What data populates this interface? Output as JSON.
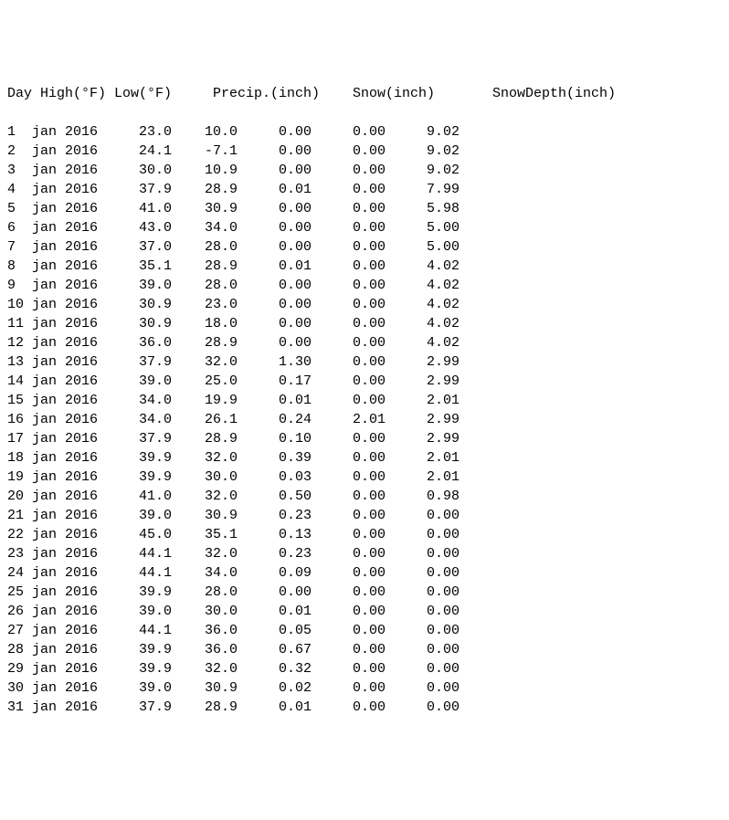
{
  "headers": {
    "day": "Day",
    "high": "High(°F)",
    "low": "Low(°F)",
    "precip": "Precip.(inch)",
    "snow": "Snow(inch)",
    "depth": "SnowDepth(inch)"
  },
  "rows": [
    {
      "day": "1",
      "date": "jan 2016",
      "high": "23.0",
      "low": "10.0",
      "precip": "0.00",
      "snow": "0.00",
      "depth": "9.02"
    },
    {
      "day": "2",
      "date": "jan 2016",
      "high": "24.1",
      "low": "-7.1",
      "precip": "0.00",
      "snow": "0.00",
      "depth": "9.02"
    },
    {
      "day": "3",
      "date": "jan 2016",
      "high": "30.0",
      "low": "10.9",
      "precip": "0.00",
      "snow": "0.00",
      "depth": "9.02"
    },
    {
      "day": "4",
      "date": "jan 2016",
      "high": "37.9",
      "low": "28.9",
      "precip": "0.01",
      "snow": "0.00",
      "depth": "7.99"
    },
    {
      "day": "5",
      "date": "jan 2016",
      "high": "41.0",
      "low": "30.9",
      "precip": "0.00",
      "snow": "0.00",
      "depth": "5.98"
    },
    {
      "day": "6",
      "date": "jan 2016",
      "high": "43.0",
      "low": "34.0",
      "precip": "0.00",
      "snow": "0.00",
      "depth": "5.00"
    },
    {
      "day": "7",
      "date": "jan 2016",
      "high": "37.0",
      "low": "28.0",
      "precip": "0.00",
      "snow": "0.00",
      "depth": "5.00"
    },
    {
      "day": "8",
      "date": "jan 2016",
      "high": "35.1",
      "low": "28.9",
      "precip": "0.01",
      "snow": "0.00",
      "depth": "4.02"
    },
    {
      "day": "9",
      "date": "jan 2016",
      "high": "39.0",
      "low": "28.0",
      "precip": "0.00",
      "snow": "0.00",
      "depth": "4.02"
    },
    {
      "day": "10",
      "date": "jan 2016",
      "high": "30.9",
      "low": "23.0",
      "precip": "0.00",
      "snow": "0.00",
      "depth": "4.02"
    },
    {
      "day": "11",
      "date": "jan 2016",
      "high": "30.9",
      "low": "18.0",
      "precip": "0.00",
      "snow": "0.00",
      "depth": "4.02"
    },
    {
      "day": "12",
      "date": "jan 2016",
      "high": "36.0",
      "low": "28.9",
      "precip": "0.00",
      "snow": "0.00",
      "depth": "4.02"
    },
    {
      "day": "13",
      "date": "jan 2016",
      "high": "37.9",
      "low": "32.0",
      "precip": "1.30",
      "snow": "0.00",
      "depth": "2.99"
    },
    {
      "day": "14",
      "date": "jan 2016",
      "high": "39.0",
      "low": "25.0",
      "precip": "0.17",
      "snow": "0.00",
      "depth": "2.99"
    },
    {
      "day": "15",
      "date": "jan 2016",
      "high": "34.0",
      "low": "19.9",
      "precip": "0.01",
      "snow": "0.00",
      "depth": "2.01"
    },
    {
      "day": "16",
      "date": "jan 2016",
      "high": "34.0",
      "low": "26.1",
      "precip": "0.24",
      "snow": "2.01",
      "depth": "2.99"
    },
    {
      "day": "17",
      "date": "jan 2016",
      "high": "37.9",
      "low": "28.9",
      "precip": "0.10",
      "snow": "0.00",
      "depth": "2.99"
    },
    {
      "day": "18",
      "date": "jan 2016",
      "high": "39.9",
      "low": "32.0",
      "precip": "0.39",
      "snow": "0.00",
      "depth": "2.01"
    },
    {
      "day": "19",
      "date": "jan 2016",
      "high": "39.9",
      "low": "30.0",
      "precip": "0.03",
      "snow": "0.00",
      "depth": "2.01"
    },
    {
      "day": "20",
      "date": "jan 2016",
      "high": "41.0",
      "low": "32.0",
      "precip": "0.50",
      "snow": "0.00",
      "depth": "0.98"
    },
    {
      "day": "21",
      "date": "jan 2016",
      "high": "39.0",
      "low": "30.9",
      "precip": "0.23",
      "snow": "0.00",
      "depth": "0.00"
    },
    {
      "day": "22",
      "date": "jan 2016",
      "high": "45.0",
      "low": "35.1",
      "precip": "0.13",
      "snow": "0.00",
      "depth": "0.00"
    },
    {
      "day": "23",
      "date": "jan 2016",
      "high": "44.1",
      "low": "32.0",
      "precip": "0.23",
      "snow": "0.00",
      "depth": "0.00"
    },
    {
      "day": "24",
      "date": "jan 2016",
      "high": "44.1",
      "low": "34.0",
      "precip": "0.09",
      "snow": "0.00",
      "depth": "0.00"
    },
    {
      "day": "25",
      "date": "jan 2016",
      "high": "39.9",
      "low": "28.0",
      "precip": "0.00",
      "snow": "0.00",
      "depth": "0.00"
    },
    {
      "day": "26",
      "date": "jan 2016",
      "high": "39.0",
      "low": "30.0",
      "precip": "0.01",
      "snow": "0.00",
      "depth": "0.00"
    },
    {
      "day": "27",
      "date": "jan 2016",
      "high": "44.1",
      "low": "36.0",
      "precip": "0.05",
      "snow": "0.00",
      "depth": "0.00"
    },
    {
      "day": "28",
      "date": "jan 2016",
      "high": "39.9",
      "low": "36.0",
      "precip": "0.67",
      "snow": "0.00",
      "depth": "0.00"
    },
    {
      "day": "29",
      "date": "jan 2016",
      "high": "39.9",
      "low": "32.0",
      "precip": "0.32",
      "snow": "0.00",
      "depth": "0.00"
    },
    {
      "day": "30",
      "date": "jan 2016",
      "high": "39.0",
      "low": "30.9",
      "precip": "0.02",
      "snow": "0.00",
      "depth": "0.00"
    },
    {
      "day": "31",
      "date": "jan 2016",
      "high": "37.9",
      "low": "28.9",
      "precip": "0.01",
      "snow": "0.00",
      "depth": "0.00"
    }
  ]
}
